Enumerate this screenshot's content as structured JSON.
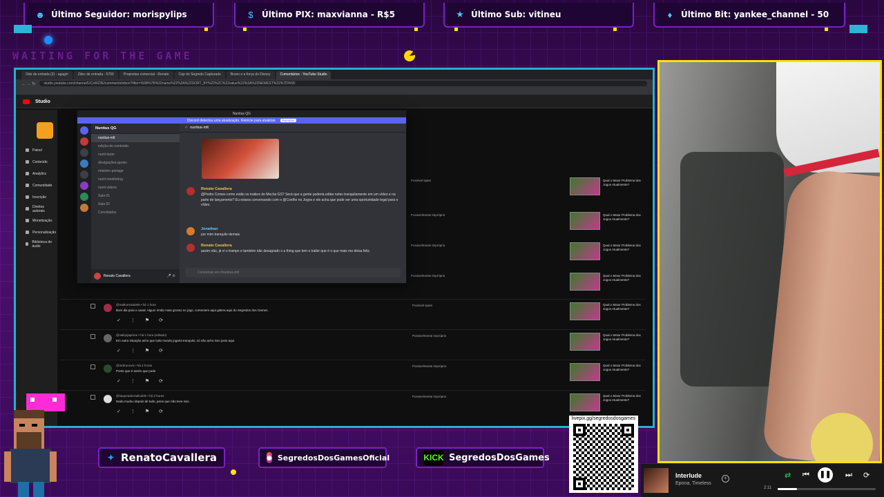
{
  "alerts": {
    "follower": "Último Seguidor: morispylips",
    "pix": "Último PIX: maxvianna - R$5",
    "sub": "Último Sub: vitineu",
    "bit": "Último Bit: yankee_channel - 50"
  },
  "waiting_text": "WAITING FOR THE GAME",
  "browser": {
    "tabs": [
      "Odo de entrada (3) - agagiri",
      "Zdoc de entrada - 5700",
      "Propostas comercial - Renato",
      "Cap do Segredo Capturado",
      "Bruno e a força do Disney",
      "Comentários - YouTube Studio"
    ],
    "active_tab": 5,
    "url": "studio.youtube.com/channel/UCxWZ3E/comments/inbox?filter=%5B%7B%22name%22%3A%22SORT_BY%22%2C%22value%22%3A%22NEWEST%22%7D%5D"
  },
  "studio": {
    "title": "Studio",
    "nav": [
      "Painel",
      "Conteúdo",
      "Analytics",
      "Comunidade",
      "Inscrição",
      "Direitos autorais",
      "Monetização",
      "Personalização",
      "Biblioteca de áudio"
    ],
    "comments": [
      {
        "meta": "@realtormaia305 • há 1 hora",
        "text": "Bom dia para o canal. Algum irmão mais grosso no jogo, comentem aqui galera aqui do Segredos dos Games.",
        "status": "Possível spam"
      },
      {
        "meta": "@valkyrjaprime • há 1 hora (editado)",
        "text": "Em outra situação acho que todo mundo jogaria tranquilo, só não acho isso justo aqui.",
        "status": "Possivelmente impróprio"
      },
      {
        "meta": "@mrbrunovic • há 2 horas",
        "text": "Ponto que é assim que pode",
        "status": "Possivelmente impróprio"
      },
      {
        "meta": "@saqueadorradical30 • há 2 horas",
        "text": "Nada mudou depois de tudo, pena que não teve isso.",
        "status": "Possivelmente impróprio"
      }
    ],
    "video_title": "Qual o Maior Problema dos Jogos Atualmente?",
    "right_status": [
      "Possível spam",
      "Possivelmente impróprio",
      "Possivelmente impróprio",
      "Possivelmente impróprio"
    ]
  },
  "discord": {
    "window_title": "Nuntius QG",
    "banner": "Discord detectou uma atualização. Reinicie para atualizar.",
    "banner_button": "Reiniciar",
    "server": "Nuntius QG",
    "channels": [
      "nuntius-mlt",
      "edição-de-conteúdo",
      "nunti-lurpe",
      "divulgações-gerais",
      "relatório-portage",
      "nunti-monitoring",
      "nunti-videos",
      "Sala 01",
      "Sala 02",
      "Convidados"
    ],
    "current_channel": "nuntius-mlt",
    "user": "Renato Cavallera",
    "messages": [
      {
        "name": "Renato Cavallera",
        "text": "@Pedro Comes como estão os trailers do Mecha GS? Será que a gente poderia editar neles tranquilamente em um vídeo e na parte de lançamento? Eu estava conversando com o @Coelho no Jogos e ele acha que pode ser uma oportunidade legal para o vídeo."
      },
      {
        "name": "Jonathan",
        "text": "por mim tranquilo demais"
      },
      {
        "name": "Renato Cavallera",
        "text": "assim não, já vi o trampo e também não desagrado o a thing que tem o trailer que é o que mais me deixa feliz."
      }
    ],
    "input_placeholder": "Conversar em #nuntius-mlt"
  },
  "socials": {
    "twitter": "RenatoCavallera",
    "instagram": "SegredosDosGamesOficial",
    "kick_label": "KICK",
    "kick": "SegredosDosGames"
  },
  "qr_url": "livepix.gg/segredosdosgames",
  "spotify": {
    "track": "Interlude",
    "artist": "Epona, Timeless",
    "time": "2:11",
    "progress": 0.2
  },
  "colors": {
    "frame": "#21b3cc",
    "camera_border": "#ffe300",
    "panel_border": "#7c1fc4"
  }
}
